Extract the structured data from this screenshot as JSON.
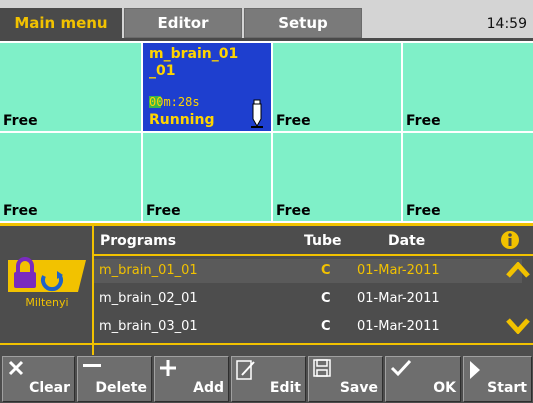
{
  "tabs": [
    {
      "label": "Main menu",
      "active": true
    },
    {
      "label": "Editor",
      "active": false
    },
    {
      "label": "Setup",
      "active": false
    }
  ],
  "clock": "14:59",
  "slots": {
    "free_label": "Free",
    "running": {
      "name": "m_brain_01_01",
      "name_line1": "m_brain_01",
      "name_line2": "_01",
      "time": "00m:28s",
      "progress_fraction": 0.12,
      "status": "Running"
    }
  },
  "programs": {
    "headers": {
      "programs": "Programs",
      "tube": "Tube",
      "date": "Date"
    },
    "rows": [
      {
        "name": "m_brain_01_01",
        "tube": "C",
        "date": "01-Mar-2011",
        "selected": true
      },
      {
        "name": "m_brain_02_01",
        "tube": "C",
        "date": "01-Mar-2011",
        "selected": false
      },
      {
        "name": "m_brain_03_01",
        "tube": "C",
        "date": "01-Mar-2011",
        "selected": false
      }
    ],
    "logo_text": "Miltenyi"
  },
  "toolbar": {
    "clear": "Clear",
    "delete": "Delete",
    "add": "Add",
    "edit": "Edit",
    "save": "Save",
    "ok": "OK",
    "start": "Start"
  },
  "colors": {
    "accent": "#f2c200",
    "slot_free": "#7ff0c8",
    "slot_running": "#1e3fcf",
    "panel": "#4d4d4d"
  }
}
